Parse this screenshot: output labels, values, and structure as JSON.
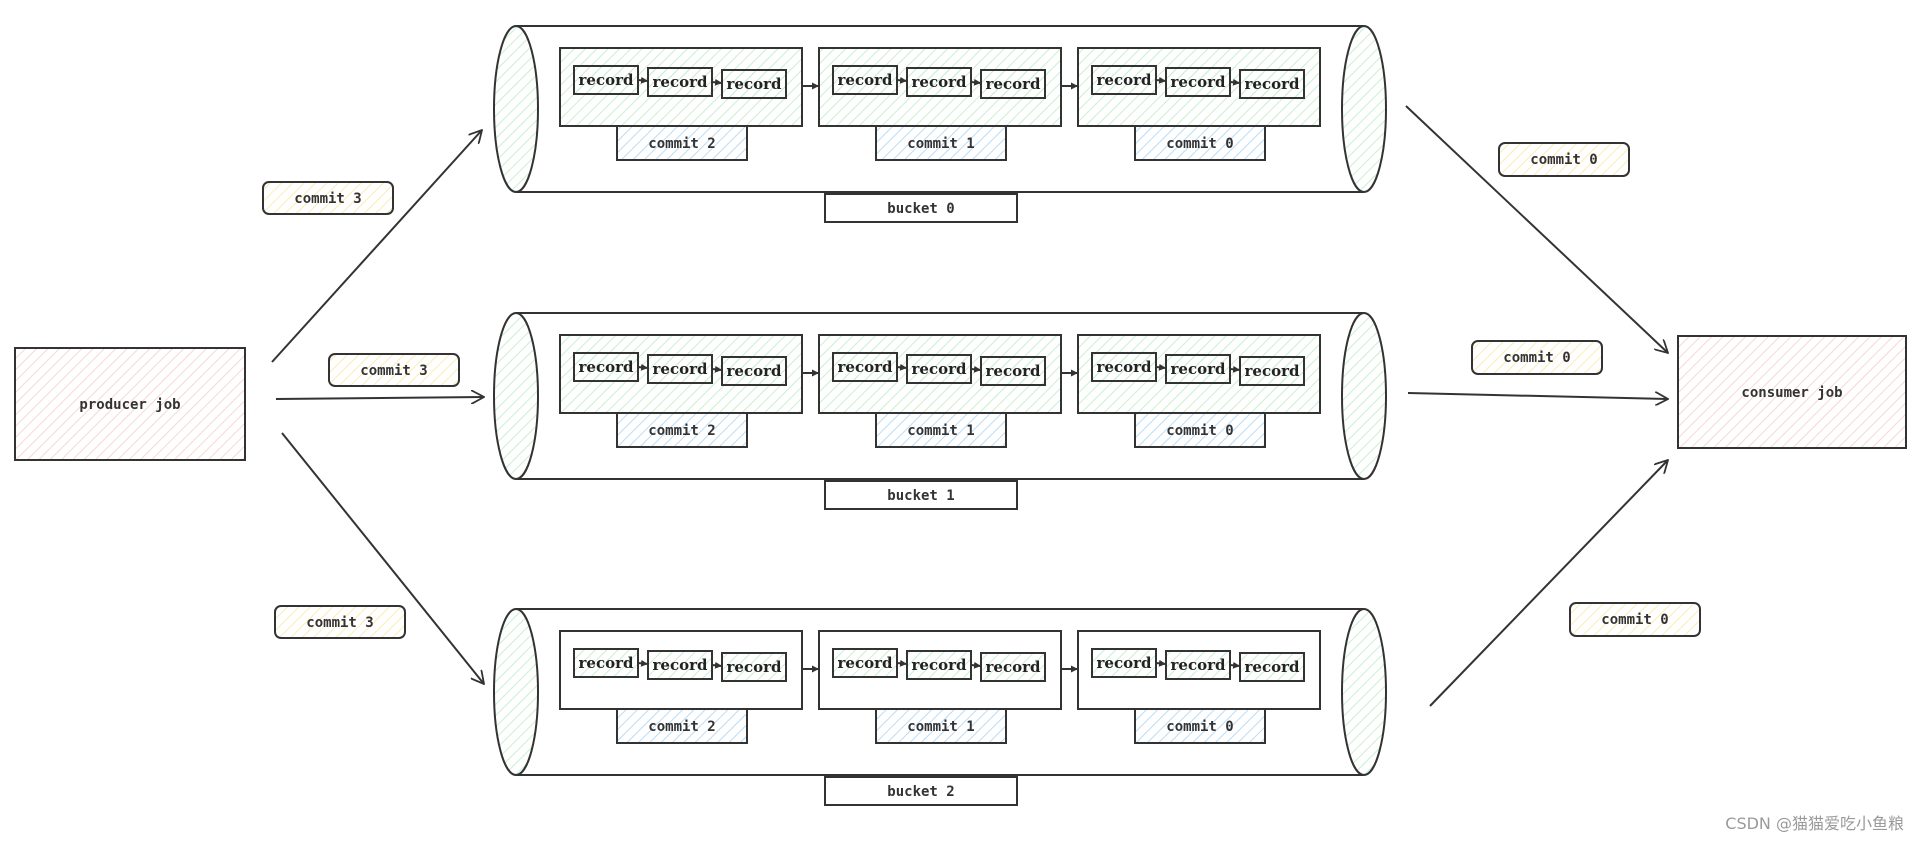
{
  "producer": {
    "label": "producer job"
  },
  "consumer": {
    "label": "consumer job"
  },
  "incoming_labels": [
    "commit 3",
    "commit 3",
    "commit 3"
  ],
  "outgoing_labels": [
    "commit 0",
    "commit 0",
    "commit 0"
  ],
  "buckets": [
    {
      "label": "bucket 0",
      "commits": [
        {
          "label": "commit 2",
          "records": [
            "record",
            "record",
            "record"
          ],
          "highlighted": true
        },
        {
          "label": "commit 1",
          "records": [
            "record",
            "record",
            "record"
          ],
          "highlighted": true
        },
        {
          "label": "commit 0",
          "records": [
            "record",
            "record",
            "record"
          ],
          "highlighted": true
        }
      ]
    },
    {
      "label": "bucket 1",
      "commits": [
        {
          "label": "commit 2",
          "records": [
            "record",
            "record",
            "record"
          ],
          "highlighted": true
        },
        {
          "label": "commit 1",
          "records": [
            "record",
            "record",
            "record"
          ],
          "highlighted": true
        },
        {
          "label": "commit 0",
          "records": [
            "record",
            "record",
            "record"
          ],
          "highlighted": true
        }
      ]
    },
    {
      "label": "bucket 2",
      "commits": [
        {
          "label": "commit 2",
          "records": [
            "record",
            "record",
            "record"
          ],
          "highlighted": false
        },
        {
          "label": "commit 1",
          "records": [
            "record",
            "record",
            "record"
          ],
          "highlighted": false
        },
        {
          "label": "commit 0",
          "records": [
            "record",
            "record",
            "record"
          ],
          "highlighted": false
        }
      ]
    }
  ],
  "colors": {
    "stroke": "#333333",
    "green_hatch": "#c9f0cf",
    "blue_hatch": "#b9dcf7",
    "yellow_hatch": "#fbecb4",
    "red_hatch": "#f6c9c9"
  },
  "watermark": "CSDN @猫猫爱吃小鱼粮"
}
